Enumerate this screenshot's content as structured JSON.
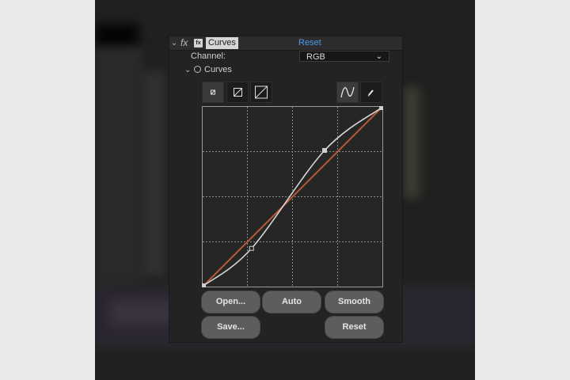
{
  "effect": {
    "name": "Curves",
    "fx_label": "fx",
    "reset_link": "Reset"
  },
  "channel": {
    "label": "Channel:",
    "selected": "RGB"
  },
  "curves_group": {
    "label": "Curves"
  },
  "tools": [
    {
      "icon": "shrink-graph-icon",
      "active": true
    },
    {
      "icon": "half-size-graph-icon",
      "active": false
    },
    {
      "icon": "full-size-graph-icon",
      "active": false
    },
    {
      "icon": "bezier-curve-tool-icon",
      "active": true
    },
    {
      "icon": "pencil-tool-icon",
      "active": false
    }
  ],
  "buttons": {
    "open": "Open...",
    "auto": "Auto",
    "smooth": "Smooth",
    "save": "Save...",
    "reset": "Reset"
  },
  "curve": {
    "control_points": [
      [
        0,
        0
      ],
      [
        0.27,
        0.21
      ],
      [
        0.68,
        0.76
      ],
      [
        1,
        1
      ]
    ],
    "baseline_color": "#b85a33",
    "curve_color": "#d8d8d8"
  }
}
